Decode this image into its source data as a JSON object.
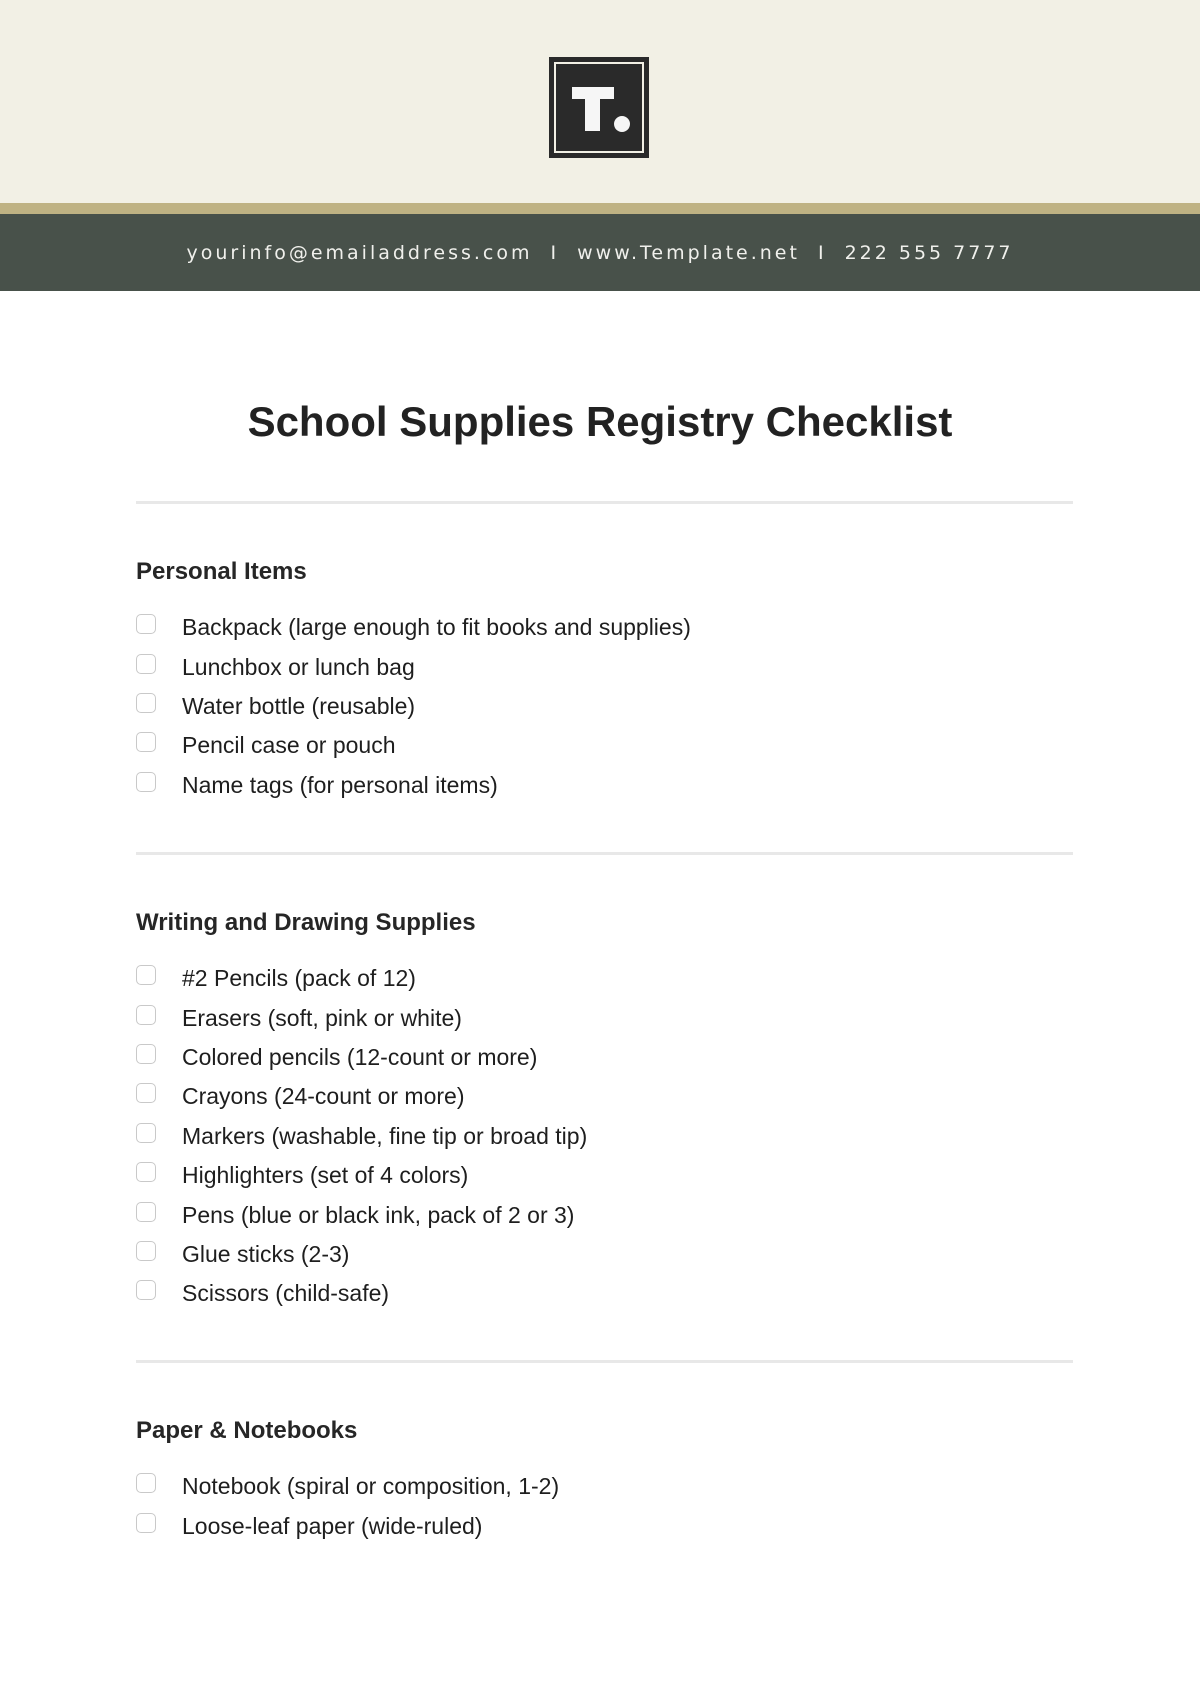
{
  "header": {
    "logo_letter": "T",
    "logo_icon": "template-logo-icon",
    "contact": {
      "email": "yourinfo@emailaddress.com",
      "website": "www.Template.net",
      "phone": "222 555 7777",
      "separator": "I"
    },
    "colors": {
      "cream": "#f2f0e5",
      "gold": "#bfb283",
      "band": "#48514a",
      "logo": "#2a2a2a"
    }
  },
  "document": {
    "title": "School Supplies Registry Checklist",
    "sections": [
      {
        "heading": "Personal Items",
        "items": [
          "Backpack (large enough to fit books and supplies)",
          "Lunchbox or lunch bag",
          "Water bottle (reusable)",
          "Pencil case or pouch",
          "Name tags (for personal items)"
        ]
      },
      {
        "heading": "Writing and Drawing Supplies",
        "items": [
          "#2 Pencils (pack of 12)",
          "Erasers (soft, pink or white)",
          "Colored pencils (12-count or more)",
          "Crayons (24-count or more)",
          "Markers (washable, fine tip or broad tip)",
          "Highlighters (set of 4 colors)",
          "Pens (blue or black ink, pack of 2 or 3)",
          "Glue sticks (2-3)",
          "Scissors (child-safe)"
        ]
      },
      {
        "heading": "Paper & Notebooks",
        "items": [
          "Notebook (spiral or composition, 1-2)",
          "Loose-leaf paper (wide-ruled)"
        ]
      }
    ]
  }
}
